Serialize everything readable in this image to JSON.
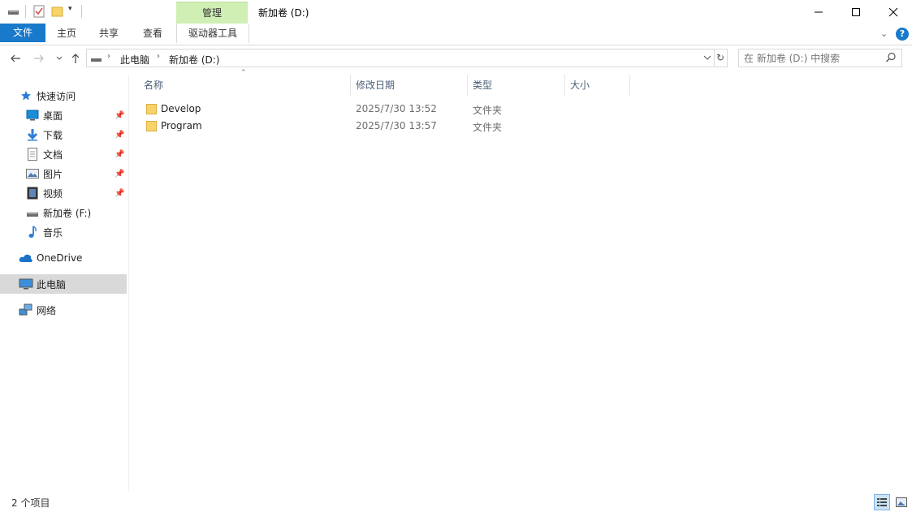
{
  "window": {
    "title": "新加卷 (D:)",
    "context_tab_label": "管理",
    "buttons": {
      "minimize": "—",
      "maximize": "☐",
      "close": "✕"
    }
  },
  "ribbon": {
    "tabs": [
      "文件",
      "主页",
      "共享",
      "查看",
      "驱动器工具"
    ]
  },
  "address": {
    "breadcrumb": [
      "此电脑",
      "新加卷 (D:)"
    ]
  },
  "search": {
    "placeholder": "在 新加卷 (D:) 中搜索"
  },
  "sidebar": {
    "quick_access": "快速访问",
    "items": [
      {
        "label": "桌面",
        "icon": "desktop-icon",
        "pinned": true
      },
      {
        "label": "下载",
        "icon": "download-icon",
        "pinned": true
      },
      {
        "label": "文档",
        "icon": "document-icon",
        "pinned": true
      },
      {
        "label": "图片",
        "icon": "picture-icon",
        "pinned": true
      },
      {
        "label": "视频",
        "icon": "video-icon",
        "pinned": true
      },
      {
        "label": "新加卷 (F:)",
        "icon": "drive-icon",
        "pinned": false
      },
      {
        "label": "音乐",
        "icon": "music-icon",
        "pinned": false
      }
    ],
    "onedrive": "OneDrive",
    "this_pc": "此电脑",
    "network": "网络"
  },
  "columns": {
    "name": "名称",
    "modified": "修改日期",
    "type": "类型",
    "size": "大小"
  },
  "files": [
    {
      "name": "Develop",
      "modified": "2025/7/30 13:52",
      "type": "文件夹",
      "size": ""
    },
    {
      "name": "Program",
      "modified": "2025/7/30 13:57",
      "type": "文件夹",
      "size": ""
    }
  ],
  "status": {
    "count": "2 个项目"
  },
  "colors": {
    "accent": "#1979ca",
    "manage_tab": "#cfefb4",
    "selected_nav": "#d9d9d9",
    "folder": "#f7d46a"
  }
}
